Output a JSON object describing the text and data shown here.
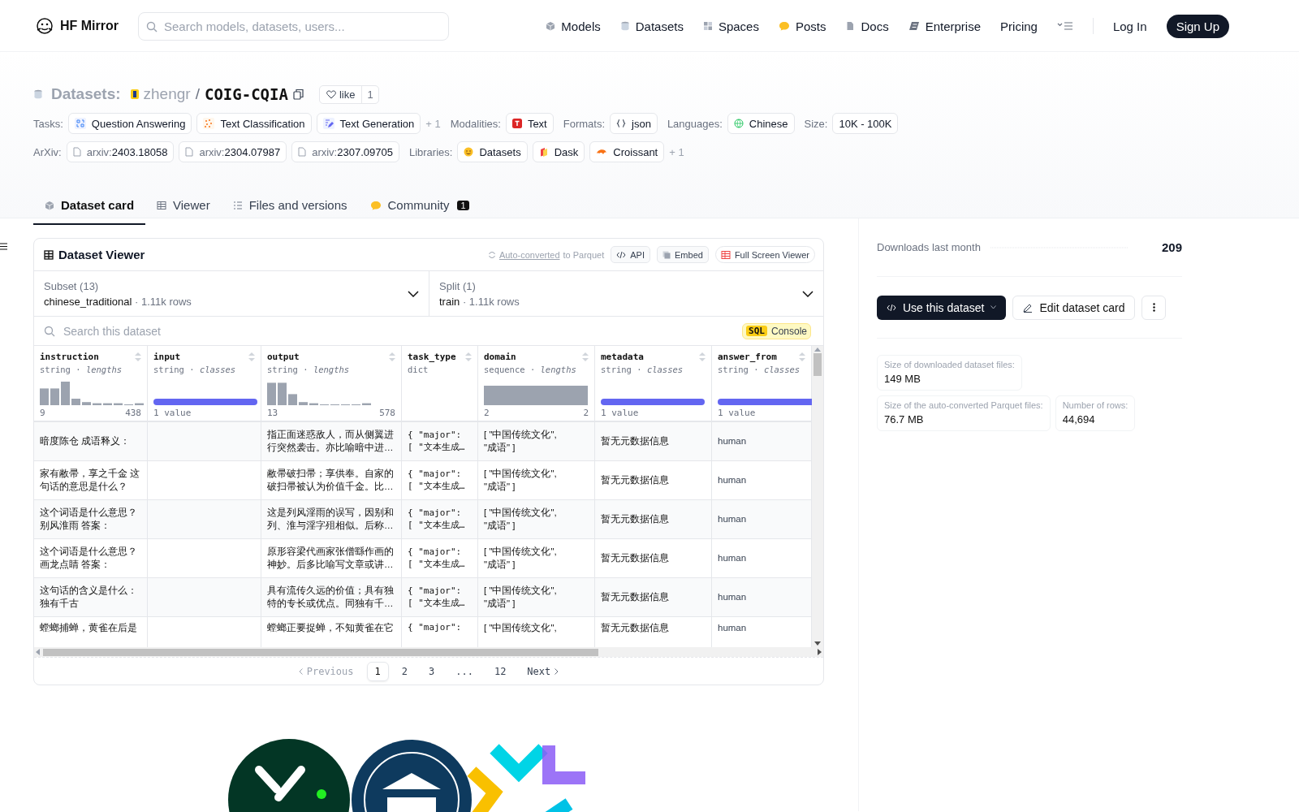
{
  "nav": {
    "logo": "HF Mirror",
    "search_placeholder": "Search models, datasets, users...",
    "links": [
      {
        "label": "Models"
      },
      {
        "label": "Datasets"
      },
      {
        "label": "Spaces"
      },
      {
        "label": "Posts"
      },
      {
        "label": "Docs"
      },
      {
        "label": "Enterprise"
      },
      {
        "label": "Pricing"
      }
    ],
    "login": "Log In",
    "signup": "Sign Up"
  },
  "repo": {
    "section": "Datasets:",
    "owner": "zhengr",
    "separator": "/",
    "name": "COIG-CQIA",
    "like": "like",
    "like_count": "1",
    "tag_rows": [
      [
        {
          "label": "Tasks:",
          "items": [
            {
              "text": "Question Answering"
            },
            {
              "text": "Text Classification"
            },
            {
              "text": "Text Generation"
            }
          ],
          "more": "+ 1"
        },
        {
          "label": "Modalities:",
          "items": [
            {
              "text": "Text"
            }
          ]
        },
        {
          "label": "Formats:",
          "items": [
            {
              "text": "json"
            }
          ]
        },
        {
          "label": "Languages:",
          "items": [
            {
              "text": "Chinese"
            }
          ]
        },
        {
          "label": "Size:",
          "items": [
            {
              "text": "10K - 100K"
            }
          ]
        }
      ],
      [
        {
          "label": "ArXiv:",
          "items": [
            {
              "prefix": "arxiv:",
              "text": "2403.18058"
            },
            {
              "prefix": "arxiv:",
              "text": "2304.07987"
            },
            {
              "prefix": "arxiv:",
              "text": "2307.09705"
            }
          ]
        },
        {
          "label": "Libraries:",
          "items": [
            {
              "text": "Datasets"
            },
            {
              "text": "Dask"
            },
            {
              "text": "Croissant"
            }
          ],
          "more": "+ 1"
        }
      ]
    ],
    "tabs": [
      {
        "label": "Dataset card",
        "selected": true
      },
      {
        "label": "Viewer",
        "selected": false
      },
      {
        "label": "Files and versions",
        "selected": false
      },
      {
        "label": "Community",
        "selected": false,
        "badge": "1"
      }
    ]
  },
  "viewer": {
    "title": "Dataset Viewer",
    "converted_link": "Auto-converted",
    "converted_rest": "to Parquet",
    "buttons": [
      {
        "label": "API"
      },
      {
        "label": "Embed"
      },
      {
        "label": "Full Screen Viewer"
      }
    ],
    "selects": [
      {
        "label": "Subset (13)",
        "value": "chinese_traditional",
        "rows": "· 1.11k rows"
      },
      {
        "label": "Split (1)",
        "value": "train",
        "rows": "· 1.11k rows"
      }
    ],
    "search_placeholder": "Search this dataset",
    "sql_badge": "SQL",
    "sql_label": "Console",
    "columns": [
      {
        "name": "instruction",
        "type": "string · *lengths*",
        "kind": "histogram",
        "min": "9",
        "max": "438"
      },
      {
        "name": "input",
        "type": "string · *classes*",
        "kind": "classbar",
        "caption": "1 value"
      },
      {
        "name": "output",
        "type": "string · *lengths*",
        "kind": "histogram",
        "min": "13",
        "max": "578"
      },
      {
        "name": "task_type",
        "type": "dict",
        "kind": "none"
      },
      {
        "name": "domain",
        "type": "sequence · *lengths*",
        "kind": "range",
        "min": "2",
        "max": "2"
      },
      {
        "name": "metadata",
        "type": "string · *classes*",
        "kind": "classbar",
        "caption": "1 value"
      },
      {
        "name": "answer_from",
        "type": "string · *classes*",
        "kind": "classbar",
        "caption": "1 value"
      }
    ],
    "rows": [
      {
        "instruction": "暗度陈仓 成语释义：",
        "output": "指正面迷惑敌人，而从侧翼进行突然袭击。亦比喻暗中进…",
        "task_type": "{ \"major\":\n[ \"文本生成…",
        "domain": "[ \"中国传统文化\",\n\"成语\" ]",
        "metadata": "暂无元数据信息",
        "answer_from": "human"
      },
      {
        "instruction": "家有敝帚，享之千金 这句话的意思是什么？",
        "output": "敝帚破扫帚；享供奉。自家的破扫帚被认为价值千金。比…",
        "task_type": "{ \"major\":\n[ \"文本生成…",
        "domain": "[ \"中国传统文化\",\n\"成语\" ]",
        "metadata": "暂无元数据信息",
        "answer_from": "human"
      },
      {
        "instruction": "这个词语是什么意思？别风淮雨 答案：",
        "output": "这是列风淫雨的误写，因别和列、淮与淫字殂相似。后称…",
        "task_type": "{ \"major\":\n[ \"文本生成…",
        "domain": "[ \"中国传统文化\",\n\"成语\" ]",
        "metadata": "暂无元数据信息",
        "answer_from": "human"
      },
      {
        "instruction": "这个词语是什么意思？画龙点睛 答案：",
        "output": "原形容梁代画家张僧繇作画的神妙。后多比喻写文章或讲…",
        "task_type": "{ \"major\":\n[ \"文本生成…",
        "domain": "[ \"中国传统文化\",\n\"成语\" ]",
        "metadata": "暂无元数据信息",
        "answer_from": "human"
      },
      {
        "instruction": "这句话的含义是什么：独有千古",
        "output": "具有流传久远的价值；具有独特的专长或优点。同独有千…",
        "task_type": "{ \"major\":\n[ \"文本生成…",
        "domain": "[ \"中国传统文化\",\n\"成语\" ]",
        "metadata": "暂无元数据信息",
        "answer_from": "human"
      },
      {
        "instruction": "螳螂捕蝉，黄雀在后是",
        "output": "螳螂正要捉蝉，不知黄雀在它",
        "task_type": "{ \"major\":",
        "domain": "[ \"中国传统文化\",",
        "metadata": "暂无元数据信息",
        "answer_from": "human"
      }
    ],
    "pages": [
      {
        "label": "Previous",
        "kind": "prev",
        "disabled": true
      },
      {
        "label": "1",
        "kind": "page",
        "selected": true
      },
      {
        "label": "2",
        "kind": "page",
        "selected": false
      },
      {
        "label": "3",
        "kind": "page",
        "selected": false
      },
      {
        "label": "...",
        "kind": "gap"
      },
      {
        "label": "12",
        "kind": "page",
        "selected": false
      },
      {
        "label": "Next",
        "kind": "next",
        "disabled": false
      }
    ]
  },
  "sidebar": {
    "downloads_label": "Downloads last month",
    "downloads": "209",
    "use_button": "Use this dataset",
    "edit_button": "Edit dataset card",
    "stats": [
      [
        {
          "label": "Size of downloaded dataset files:",
          "value": "149 MB"
        }
      ],
      [
        {
          "label": "Size of the auto-converted Parquet files:",
          "value": "76.7 MB"
        },
        {
          "label": "Number of rows:",
          "value": "44,694"
        }
      ]
    ]
  }
}
